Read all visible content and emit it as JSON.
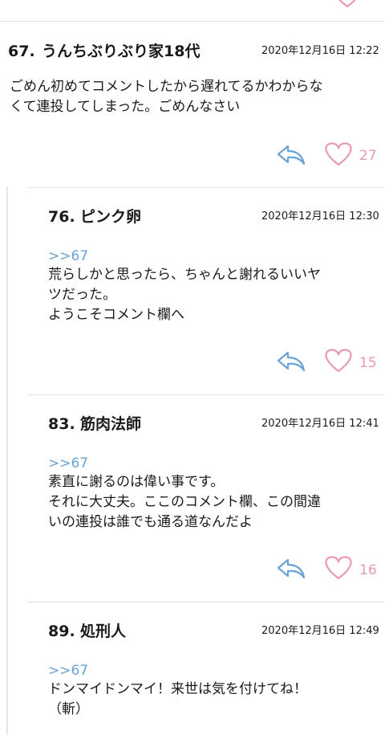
{
  "colors": {
    "reply": "#6aa3d6",
    "like": "#e89bb0",
    "anchor": "#6aa3d6"
  },
  "comments": [
    {
      "number": "67.",
      "author": "うんちぶりぶり家18代",
      "date": "2020年12月16日 12:22",
      "lines": [
        "ごめん初めてコメントしたから遅れてるかわからな",
        "くて連投してしまった。ごめんなさい"
      ],
      "like_count": "27"
    },
    {
      "number": "76.",
      "author": "ピンク卵",
      "date": "2020年12月16日 12:30",
      "anchor": ">>67",
      "lines": [
        "荒らしかと思ったら、ちゃんと謝れるいいヤ",
        "ツだった。",
        "ようこそコメント欄へ"
      ],
      "like_count": "15"
    },
    {
      "number": "83.",
      "author": "筋肉法師",
      "date": "2020年12月16日 12:41",
      "anchor": ">>67",
      "lines": [
        "素直に謝るのは偉い事です。",
        "それに大丈夫。ここのコメント欄、この間違",
        "いの連投は誰でも通る道なんだよ"
      ],
      "like_count": "16"
    },
    {
      "number": "89.",
      "author": "処刑人",
      "date": "2020年12月16日 12:49",
      "anchor": ">>67",
      "lines": [
        "ドンマイドンマイ！来世は気を付けてね！",
        "（斬）"
      ]
    }
  ]
}
